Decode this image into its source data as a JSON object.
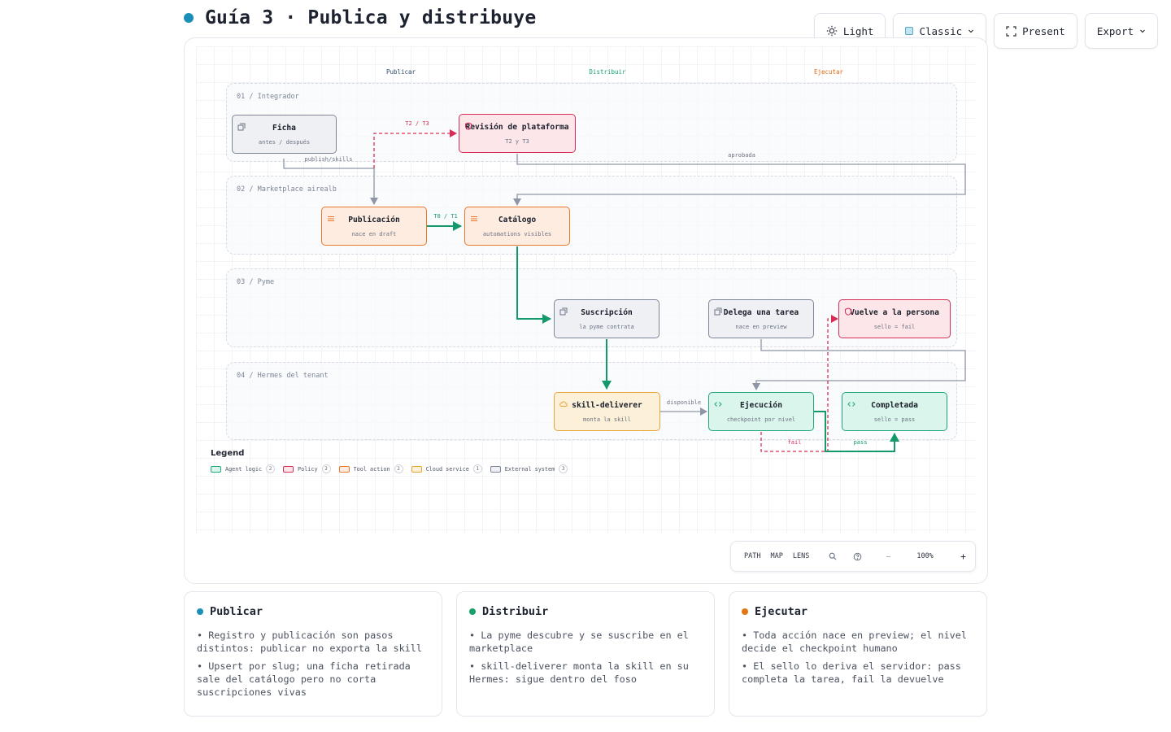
{
  "header": {
    "title": "Guía 3 · Publica y distribuye",
    "dot_color": "#1b8fb8"
  },
  "toolbar": {
    "theme_label": "Light",
    "style_label": "Classic",
    "present_label": "Present",
    "export_label": "Export"
  },
  "columns": [
    {
      "label": "Publicar",
      "color": "#2d4a6b"
    },
    {
      "label": "Distribuir",
      "color": "#16a06a"
    },
    {
      "label": "Ejecutar",
      "color": "#e06a12"
    }
  ],
  "lanes": [
    "01 / Integrador",
    "02 / Marketplace airealb",
    "03 / Pyme",
    "04 / Hermes del tenant"
  ],
  "nodes": {
    "ficha": {
      "title": "Ficha",
      "sub": "antes / después",
      "kind": "external-system"
    },
    "revision": {
      "title": "Revisión de plataforma",
      "sub": "T2 y T3",
      "kind": "policy"
    },
    "publicacion": {
      "title": "Publicación",
      "sub": "nace en draft",
      "kind": "tool-action"
    },
    "catalogo": {
      "title": "Catálogo",
      "sub": "automations visibles",
      "kind": "tool-action"
    },
    "suscripcion": {
      "title": "Suscripción",
      "sub": "la pyme contrata",
      "kind": "external-system"
    },
    "delega": {
      "title": "Delega una tarea",
      "sub": "nace en preview",
      "kind": "external-system"
    },
    "vuelve": {
      "title": "Vuelve a la persona",
      "sub": "sello = fail",
      "kind": "policy"
    },
    "skill": {
      "title": "skill-deliverer",
      "sub": "monta la skill",
      "kind": "cloud-service"
    },
    "ejecucion": {
      "title": "Ejecución",
      "sub": "checkpoint por nivel",
      "kind": "agent-logic"
    },
    "completada": {
      "title": "Completada",
      "sub": "sello = pass",
      "kind": "agent-logic"
    }
  },
  "edges": {
    "publish_skills": "publish/skills",
    "t2_t3": "T2 / T3",
    "aprobada": "aprobada",
    "t0_t1": "T0 / T1",
    "disponible": "disponible",
    "fail": "fail",
    "pass": "pass"
  },
  "legend": {
    "title": "Legend",
    "items": [
      {
        "label": "Agent logic",
        "count": "2",
        "fill": "#daf5ec",
        "stroke": "#1da779"
      },
      {
        "label": "Policy",
        "count": "2",
        "fill": "#fde6ea",
        "stroke": "#d72e55"
      },
      {
        "label": "Tool action",
        "count": "2",
        "fill": "#fdecdf",
        "stroke": "#e6772c"
      },
      {
        "label": "Cloud service",
        "count": "1",
        "fill": "#fdf0d8",
        "stroke": "#e8a33a"
      },
      {
        "label": "External system",
        "count": "3",
        "fill": "#eef0f4",
        "stroke": "#7d8699"
      }
    ]
  },
  "viewbar": {
    "path": "PATH",
    "map": "MAP",
    "lens": "LENS",
    "zoom": "100%"
  },
  "cards": [
    {
      "title": "Publicar",
      "dot": "#1b8fb8",
      "items": [
        "• Registro y publicación son pasos distintos: publicar no exporta la skill",
        "• Upsert por slug; una ficha retirada sale del catálogo pero no corta suscripciones vivas"
      ]
    },
    {
      "title": "Distribuir",
      "dot": "#16a06a",
      "items": [
        "• La pyme descubre y se suscribe en el marketplace",
        "• skill-deliverer monta la skill en su Hermes: sigue dentro del foso"
      ]
    },
    {
      "title": "Ejecutar",
      "dot": "#e0770f",
      "items": [
        "• Toda acción nace en preview; el nivel decide el checkpoint humano",
        "• El sello lo deriva el servidor: pass completa la tarea, fail la devuelve"
      ]
    }
  ]
}
